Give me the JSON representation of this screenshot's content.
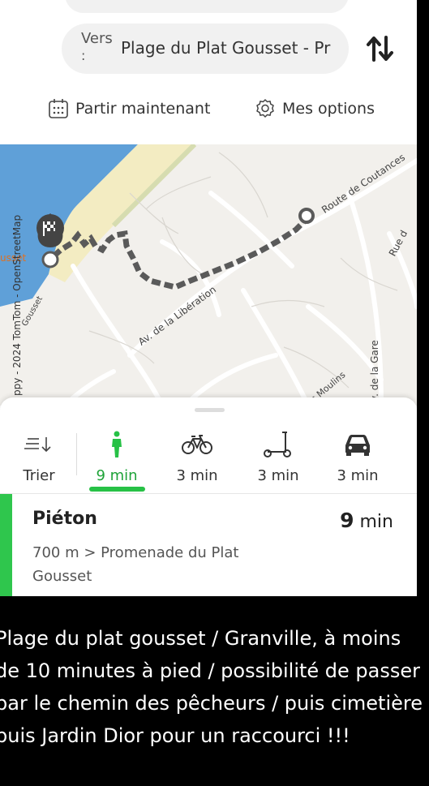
{
  "search": {
    "dest_prefix": "Vers",
    "dest_colon": ":",
    "destination": "Plage du Plat Gousset - Pr"
  },
  "options": {
    "depart_label": "Partir maintenant",
    "options_label": "Mes options"
  },
  "map": {
    "attribution": "ppy - 2024 TomTom - OpenStreetMap",
    "labels": {
      "route_coutances": "Route de Coutances",
      "rue": "Rue d",
      "av_liberation": "Av. de la Libération",
      "gousset": "Gousset",
      "moulins": "s Moulins",
      "gare": "v. de la Gare",
      "sset": "usset"
    }
  },
  "modes": {
    "sort_label": "Trier",
    "walk_time": "9 min",
    "bike_time": "3 min",
    "scooter_time": "3 min",
    "car_time": "3 min"
  },
  "route": {
    "title": "Piéton",
    "time_value": "9",
    "time_unit": "min",
    "description": "700 m > Promenade du Plat Gousset"
  },
  "caption": "Plage du plat gousset / Granville, à moins de 10 minutes à pied / possibilité de passer par le chemin des pêcheurs / puis cimetière puis Jardin Dior pour un raccourci !!!",
  "colors": {
    "accent_green": "#27c146",
    "route_color": "#5a5a5a",
    "sea": "#5fa0d8",
    "beach": "#f3ecc2"
  }
}
